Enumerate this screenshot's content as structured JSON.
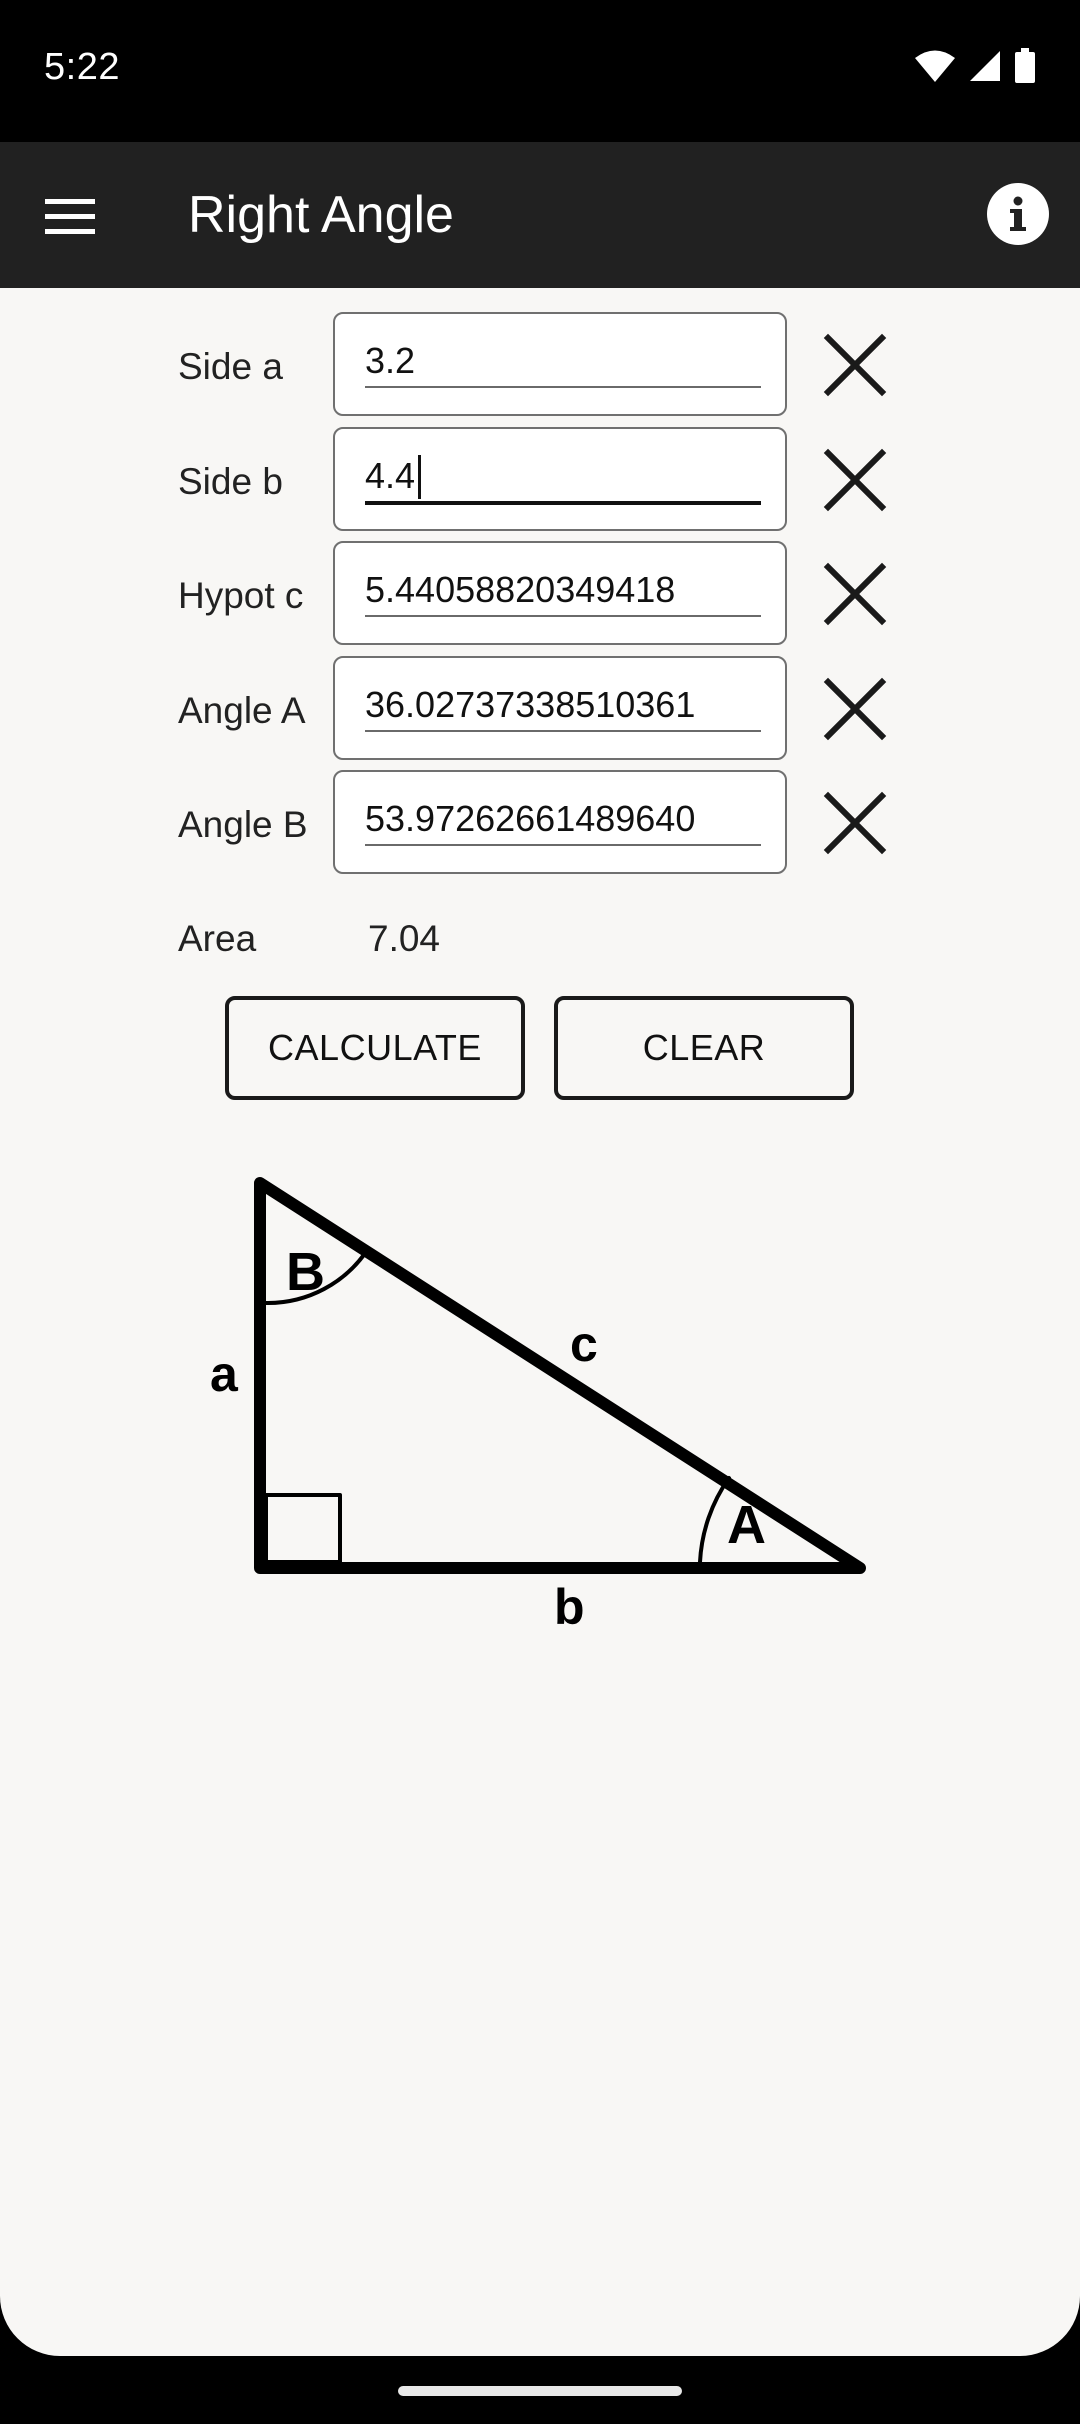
{
  "status_bar": {
    "time": "5:22",
    "icons": [
      "wifi-icon",
      "cell-signal-icon",
      "battery-icon"
    ]
  },
  "app_bar": {
    "title": "Right Angle",
    "menu_icon": "hamburger-menu-icon",
    "info_icon": "info-icon"
  },
  "fields": [
    {
      "label": "Side a",
      "value": "3.2",
      "focused": false
    },
    {
      "label": "Side b",
      "value": "4.4",
      "focused": true
    },
    {
      "label": "Hypot c",
      "value": "5.44058820349418",
      "focused": false
    },
    {
      "label": "Angle A",
      "value": "36.02737338510361",
      "focused": false
    },
    {
      "label": "Angle B",
      "value": "53.97262661489640",
      "focused": false
    }
  ],
  "area": {
    "label": "Area",
    "value": "7.04"
  },
  "buttons": {
    "calculate": "CALCULATE",
    "clear": "CLEAR"
  },
  "diagram": {
    "vertex_b": "B",
    "vertex_a": "A",
    "side_a": "a",
    "side_b": "b",
    "side_c": "c"
  },
  "colors": {
    "app_bar": "#212121",
    "background": "#f8f7f5",
    "status_bar": "#000000"
  }
}
